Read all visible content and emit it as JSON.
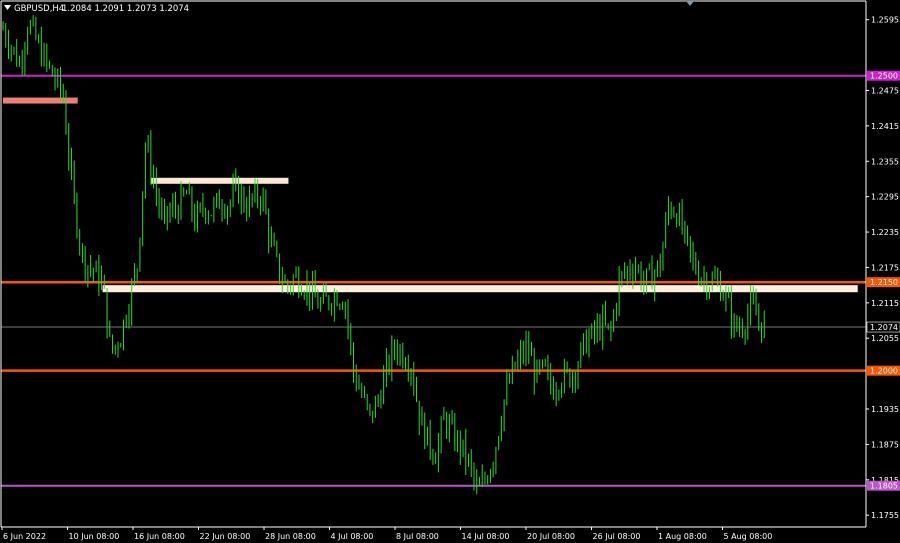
{
  "header": {
    "symbol_timeframe": "GBPUSD,H4",
    "quote": "1.2084 1.2091 1.2073 1.2074"
  },
  "colors": {
    "background": "#000000",
    "candle": "#22dd22",
    "axis": "#ffffff",
    "current_price_line": "#888888"
  },
  "chart_data": {
    "type": "candlestick",
    "title": "",
    "ylim": [
      1.1735,
      1.2625
    ],
    "y_ticks": [
      "1.2595",
      "1.2475",
      "1.2415",
      "1.2355",
      "1.2295",
      "1.2235",
      "1.2175",
      "1.2115",
      "1.2055",
      "1.1935",
      "1.1875",
      "1.1815",
      "1.1755"
    ],
    "x_ticks": [
      "6 Jun 2022",
      "10 Jun 08:00",
      "16 Jun 08:00",
      "22 Jun 08:00",
      "28 Jun 08:00",
      "4 Jul 08:00",
      "8 Jul 08:00",
      "14 Jul 08:00",
      "20 Jul 08:00",
      "26 Jul 08:00",
      "1 Aug 08:00",
      "5 Aug 08:00"
    ],
    "price_path": [
      {
        "x": 0.0,
        "y": 1.258
      },
      {
        "x": 0.5,
        "y": 1.255
      },
      {
        "x": 1.0,
        "y": 1.252
      },
      {
        "x": 1.5,
        "y": 1.259
      },
      {
        "x": 2.0,
        "y": 1.256
      },
      {
        "x": 2.6,
        "y": 1.252
      },
      {
        "x": 3.0,
        "y": 1.25
      },
      {
        "x": 3.6,
        "y": 1.247
      },
      {
        "x": 4.2,
        "y": 1.23
      },
      {
        "x": 4.8,
        "y": 1.219
      },
      {
        "x": 5.4,
        "y": 1.217
      },
      {
        "x": 6.0,
        "y": 1.215
      },
      {
        "x": 6.5,
        "y": 1.203
      },
      {
        "x": 7.1,
        "y": 1.206
      },
      {
        "x": 7.6,
        "y": 1.212
      },
      {
        "x": 8.1,
        "y": 1.218
      },
      {
        "x": 8.6,
        "y": 1.239
      },
      {
        "x": 9.1,
        "y": 1.232
      },
      {
        "x": 9.6,
        "y": 1.225
      },
      {
        "x": 10.1,
        "y": 1.227
      },
      {
        "x": 10.6,
        "y": 1.228
      },
      {
        "x": 11.1,
        "y": 1.23
      },
      {
        "x": 11.6,
        "y": 1.225
      },
      {
        "x": 12.1,
        "y": 1.228
      },
      {
        "x": 12.6,
        "y": 1.227
      },
      {
        "x": 13.1,
        "y": 1.229
      },
      {
        "x": 13.6,
        "y": 1.228
      },
      {
        "x": 14.1,
        "y": 1.231
      },
      {
        "x": 14.6,
        "y": 1.228
      },
      {
        "x": 15.1,
        "y": 1.229
      },
      {
        "x": 15.6,
        "y": 1.23
      },
      {
        "x": 16.1,
        "y": 1.222
      },
      {
        "x": 16.6,
        "y": 1.217
      },
      {
        "x": 17.1,
        "y": 1.214
      },
      {
        "x": 17.6,
        "y": 1.216
      },
      {
        "x": 18.1,
        "y": 1.215
      },
      {
        "x": 18.6,
        "y": 1.213
      },
      {
        "x": 19.1,
        "y": 1.211
      },
      {
        "x": 19.6,
        "y": 1.212
      },
      {
        "x": 20.1,
        "y": 1.213
      },
      {
        "x": 20.6,
        "y": 1.212
      },
      {
        "x": 21.1,
        "y": 1.2
      },
      {
        "x": 21.6,
        "y": 1.196
      },
      {
        "x": 22.1,
        "y": 1.192
      },
      {
        "x": 22.6,
        "y": 1.195
      },
      {
        "x": 23.1,
        "y": 1.2
      },
      {
        "x": 23.6,
        "y": 1.204
      },
      {
        "x": 24.1,
        "y": 1.203
      },
      {
        "x": 24.6,
        "y": 1.201
      },
      {
        "x": 25.1,
        "y": 1.192
      },
      {
        "x": 25.6,
        "y": 1.188
      },
      {
        "x": 26.1,
        "y": 1.186
      },
      {
        "x": 26.6,
        "y": 1.192
      },
      {
        "x": 27.1,
        "y": 1.189
      },
      {
        "x": 27.6,
        "y": 1.187
      },
      {
        "x": 28.1,
        "y": 1.184
      },
      {
        "x": 28.6,
        "y": 1.179
      },
      {
        "x": 29.1,
        "y": 1.182
      },
      {
        "x": 29.6,
        "y": 1.186
      },
      {
        "x": 30.1,
        "y": 1.194
      },
      {
        "x": 30.6,
        "y": 1.199
      },
      {
        "x": 31.1,
        "y": 1.202
      },
      {
        "x": 31.6,
        "y": 1.204
      },
      {
        "x": 32.1,
        "y": 1.199
      },
      {
        "x": 32.6,
        "y": 1.2
      },
      {
        "x": 33.1,
        "y": 1.197
      },
      {
        "x": 33.6,
        "y": 1.199
      },
      {
        "x": 34.1,
        "y": 1.199
      },
      {
        "x": 34.6,
        "y": 1.201
      },
      {
        "x": 35.1,
        "y": 1.205
      },
      {
        "x": 35.6,
        "y": 1.206
      },
      {
        "x": 36.1,
        "y": 1.208
      },
      {
        "x": 36.6,
        "y": 1.206
      },
      {
        "x": 37.1,
        "y": 1.215
      },
      {
        "x": 37.6,
        "y": 1.217
      },
      {
        "x": 38.1,
        "y": 1.218
      },
      {
        "x": 38.6,
        "y": 1.215
      },
      {
        "x": 39.1,
        "y": 1.216
      },
      {
        "x": 39.6,
        "y": 1.218
      },
      {
        "x": 40.1,
        "y": 1.228
      },
      {
        "x": 40.6,
        "y": 1.227
      },
      {
        "x": 41.1,
        "y": 1.222
      },
      {
        "x": 41.6,
        "y": 1.218
      },
      {
        "x": 42.1,
        "y": 1.216
      },
      {
        "x": 42.6,
        "y": 1.215
      },
      {
        "x": 43.1,
        "y": 1.215
      },
      {
        "x": 43.6,
        "y": 1.212
      },
      {
        "x": 44.1,
        "y": 1.207
      },
      {
        "x": 44.6,
        "y": 1.208
      },
      {
        "x": 45.1,
        "y": 1.211
      },
      {
        "x": 45.6,
        "y": 1.208
      },
      {
        "x": 46.0,
        "y": 1.2074
      }
    ],
    "x_domain": [
      0,
      52
    ],
    "horizontal_levels": [
      {
        "price": 1.25,
        "label": "1.2500",
        "color": "#cc22cc",
        "thickness": 2
      },
      {
        "price": 1.215,
        "label": "1.2150",
        "color": "#ff5500",
        "thickness": 2.5
      },
      {
        "price": 1.2074,
        "label": "1.2074",
        "color": "#777777",
        "thickness": 1
      },
      {
        "price": 1.2,
        "label": "1.2000",
        "color": "#ff5500",
        "thickness": 2.5
      },
      {
        "price": 1.1805,
        "label": "1.1805",
        "color": "#bb55cc",
        "thickness": 2
      }
    ],
    "zones": [
      {
        "x0": 0.0,
        "x1": 4.5,
        "y0": 1.2463,
        "y1": 1.2453,
        "color": "#f08070"
      },
      {
        "x0": 8.9,
        "x1": 17.2,
        "y0": 1.2327,
        "y1": 1.2317,
        "color": "#ffe8d0"
      },
      {
        "x0": 6.0,
        "x1": 51.5,
        "y0": 1.2145,
        "y1": 1.2133,
        "color": "#fff0e0"
      }
    ]
  }
}
